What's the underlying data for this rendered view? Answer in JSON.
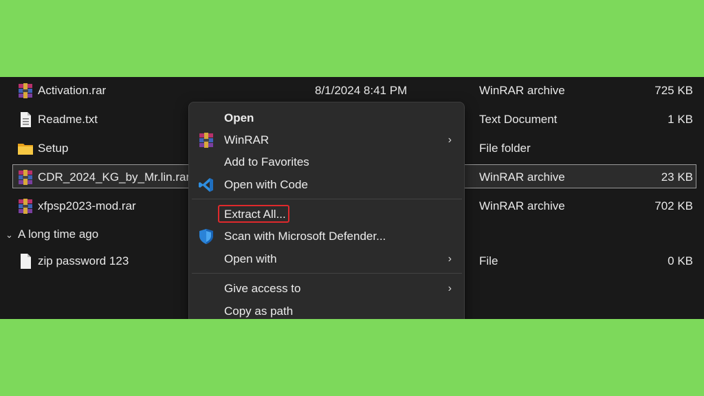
{
  "files": [
    {
      "name": "Activation.rar",
      "date": "8/1/2024 8:41 PM",
      "type": "WinRAR archive",
      "size": "725 KB",
      "icon": "winrar-icon"
    },
    {
      "name": "Readme.txt",
      "date": "",
      "type": "Text Document",
      "size": "1 KB",
      "icon": "text-file-icon"
    },
    {
      "name": "Setup",
      "date": "",
      "type": "File folder",
      "size": "",
      "icon": "folder-icon"
    },
    {
      "name": "CDR_2024_KG_by_Mr.lin.rar",
      "date": "",
      "type": "WinRAR archive",
      "size": "23 KB",
      "icon": "winrar-icon",
      "selected": true
    },
    {
      "name": "xfpsp2023-mod.rar",
      "date": "",
      "type": "WinRAR archive",
      "size": "702 KB",
      "icon": "winrar-icon"
    }
  ],
  "group": {
    "label": "A long time ago"
  },
  "old_files": [
    {
      "name": "zip password 123",
      "date": "",
      "type": "File",
      "size": "0 KB",
      "icon": "blank-file-icon"
    }
  ],
  "context_menu": {
    "items": [
      {
        "label": "Open",
        "bold": true
      },
      {
        "label": "WinRAR",
        "icon": "winrar-icon",
        "submenu": true
      },
      {
        "label": "Add to Favorites"
      },
      {
        "label": "Open with Code",
        "icon": "vscode-icon"
      },
      {
        "label": "Extract All...",
        "highlighted": true
      },
      {
        "label": "Scan with Microsoft Defender...",
        "icon": "defender-shield-icon"
      },
      {
        "label": "Open with",
        "submenu": true
      },
      {
        "label": "Give access to",
        "submenu": true
      },
      {
        "label": "Copy as path"
      }
    ]
  },
  "colors": {
    "background": "#7dd95b",
    "panel": "#191919",
    "menu": "#2b2b2b",
    "highlight_box": "#e0292c"
  }
}
